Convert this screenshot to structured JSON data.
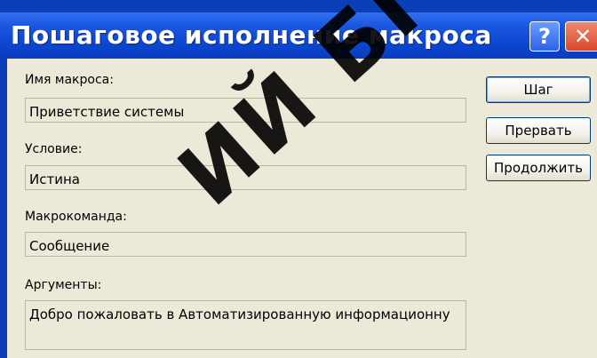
{
  "window": {
    "title": "Пошаговое исполнение макроса",
    "help_label": "?",
    "close_label": "✕"
  },
  "fields": {
    "macro_name": {
      "label": "Имя макроса:",
      "value": "Приветствие системы"
    },
    "condition": {
      "label": "Условие:",
      "value": "Истина"
    },
    "action": {
      "label": "Макрокоманда:",
      "value": "Сообщение"
    },
    "arguments": {
      "label": "Аргументы:",
      "value": "Добро пожаловать в Автоматизированную информационну"
    }
  },
  "buttons": {
    "step": "Шаг",
    "halt": "Прервать",
    "continue": "Продолжить"
  },
  "watermark": "ИЙ БГУИР",
  "colors": {
    "title_bar": "#0b46d0",
    "client_bg": "#ece9d8",
    "close_button": "#d8482a"
  }
}
